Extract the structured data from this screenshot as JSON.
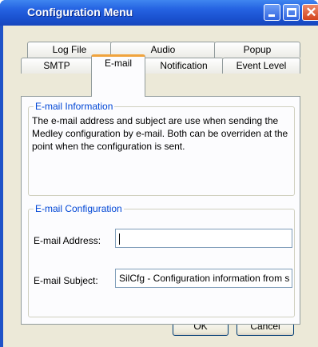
{
  "window": {
    "title": "Configuration Menu"
  },
  "tabs_back": [
    "Log File",
    "Audio",
    "Popup"
  ],
  "tabs_front": [
    "SMTP",
    "E-mail",
    "Notification",
    "Event Level"
  ],
  "active_tab": "E-mail",
  "info_group": {
    "title": "E-mail Information",
    "text": "The e-mail address and subject are use when sending the Medley configuration by e-mail. Both can be overriden at the point when the configuration is sent."
  },
  "config_group": {
    "title": "E-mail Configuration",
    "address_label": "E-mail Address:",
    "address_value": "",
    "subject_label": "E-mail Subject:",
    "subject_value": "SilCfg - Configuration information from s"
  },
  "buttons": {
    "ok": "OK",
    "cancel": "Cancel"
  },
  "colors": {
    "titlebar": "#2563e2",
    "client": "#ece9d8",
    "active_tab_accent": "#f0a33c",
    "group_title": "#0046d5"
  }
}
